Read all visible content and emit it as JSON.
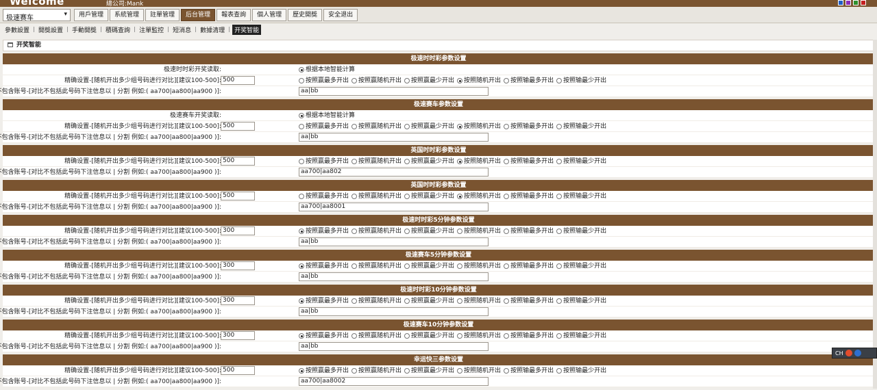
{
  "header": {
    "logo": "Welcome",
    "company": "總公司:Mank",
    "swatches": [
      "#1f5cc4",
      "#8a2bb8",
      "#2d8f2d",
      "#c42020"
    ]
  },
  "nav": {
    "game_select": "极速赛车",
    "menu": [
      {
        "label": "用戶管理",
        "active": false
      },
      {
        "label": "系統管理",
        "active": false
      },
      {
        "label": "註單管理",
        "active": false
      },
      {
        "label": "后台管理",
        "active": true
      },
      {
        "label": "報表查詢",
        "active": false
      },
      {
        "label": "個人管理",
        "active": false
      },
      {
        "label": "歷史開獎",
        "active": false
      },
      {
        "label": "安全退出",
        "active": false
      }
    ]
  },
  "subnav": [
    {
      "label": "參數設置",
      "active": false
    },
    {
      "label": "開獎設置",
      "active": false
    },
    {
      "label": "手動開獎",
      "active": false
    },
    {
      "label": "積碼查詢",
      "active": false
    },
    {
      "label": "注單監控",
      "active": false
    },
    {
      "label": "短消息",
      "active": false
    },
    {
      "label": "數據清理",
      "active": false
    },
    {
      "label": "开奖智能",
      "active": true
    }
  ],
  "panel": {
    "title": "开奖智能"
  },
  "labels": {
    "compare_setting": "精确设置-[随机开出多少组号码进行对比][建议100-500]:",
    "exclude_account": "不包含账号-[对比不包括此号码下注信息以 | 分割 例如:( aa700|aa800|aa900 )]:",
    "local_compute": "根据本地智能计算"
  },
  "option_labels": [
    "按照赢最多开出",
    "按照赢随机开出",
    "按照赢最少开出",
    "按照随机开出",
    "按照输最多开出",
    "按照输最少开出"
  ],
  "sections": [
    {
      "title": "极速时时彩参数设置",
      "source_label": "极速时时彩开奖读取:",
      "compare_value": "500",
      "selected": 3,
      "exclude_value": "aa|bb"
    },
    {
      "title": "极速赛车参数设置",
      "source_label": "极速赛车开奖读取:",
      "compare_value": "500",
      "selected": 3,
      "exclude_value": "aa|bb"
    },
    {
      "title": "英国时时彩参数设置",
      "source_label": "",
      "compare_value": "500",
      "selected": 3,
      "exclude_value": "aa700|aa802"
    },
    {
      "title": "英国时时彩参数设置",
      "source_label": "",
      "compare_value": "500",
      "selected": 3,
      "exclude_value": "aa700|aa8001"
    },
    {
      "title": "极速时时彩5分钟参数设置",
      "source_label": "",
      "compare_value": "300",
      "selected": 0,
      "exclude_value": "aa|bb"
    },
    {
      "title": "极速赛车5分钟参数设置",
      "source_label": "",
      "compare_value": "300",
      "selected": 0,
      "exclude_value": "aa|bb"
    },
    {
      "title": "极速时时彩10分钟参数设置",
      "source_label": "",
      "compare_value": "300",
      "selected": 0,
      "exclude_value": "aa|bb"
    },
    {
      "title": "极速赛车10分钟参数设置",
      "source_label": "",
      "compare_value": "300",
      "selected": 0,
      "exclude_value": "aa|bb"
    },
    {
      "title": "幸运快三参数设置",
      "source_label": "",
      "compare_value": "500",
      "selected": 0,
      "exclude_value": "aa700|aa8002"
    }
  ],
  "ime": {
    "label": "CH"
  }
}
